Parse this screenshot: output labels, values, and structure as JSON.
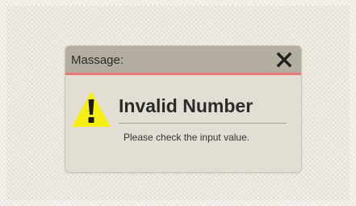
{
  "dialog": {
    "title": "Massage:",
    "heading": "Invalid Number",
    "message": "Please check the input value.",
    "close_icon": "close-icon",
    "warning_icon": "warning-icon"
  },
  "colors": {
    "titlebar": "#b3ae9f",
    "titlebar_accent": "#e87a7a",
    "dialog_body": "#e2ded3",
    "warning_yellow": "#f5ef14"
  }
}
